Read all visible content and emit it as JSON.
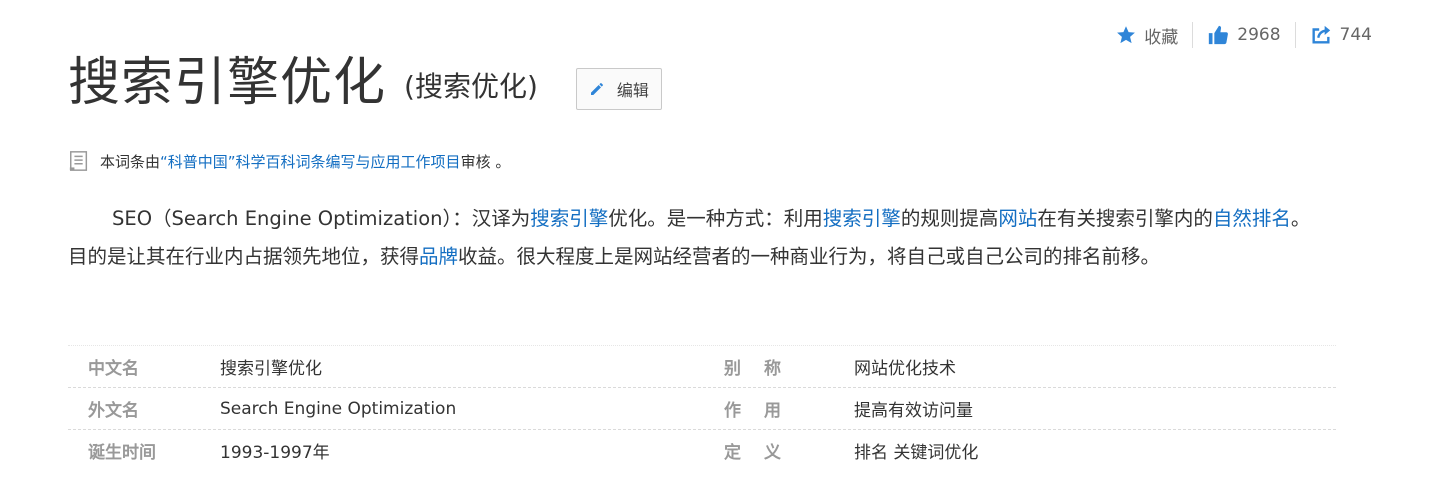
{
  "actions": {
    "favorite_label": "收藏",
    "like_count": "2968",
    "share_count": "744",
    "accent_color": "#2f85d8"
  },
  "title": {
    "main": "搜索引擎优化",
    "sub": "(搜索优化)",
    "edit_label": "编辑"
  },
  "review": {
    "prefix": "本词条由",
    "link": "“科普中国”科学百科词条编写与应用工作项目",
    "suffix": " 审核 。"
  },
  "summary": {
    "parts": [
      "SEO（Search Engine Optimization）：汉译为",
      "搜索引擎",
      "优化。是一种方式：利用",
      "搜索引擎",
      "的规则提高",
      "网站",
      "在有关搜索引擎内的",
      "自然排名",
      "。目的是让其在行业内占据领先地位，获得",
      "品牌",
      "收益。很大程度上是网站经营者的一种商业行为，将自己或自己公司的排名前移。"
    ]
  },
  "basic_info": [
    {
      "name": "中文名",
      "value": "搜索引擎优化",
      "name2": "别　称",
      "value2": "网站优化技术"
    },
    {
      "name": "外文名",
      "value": "Search Engine Optimization",
      "name2": "作　用",
      "value2": "提高有效访问量"
    },
    {
      "name": "诞生时间",
      "value": "1993-1997年",
      "name2": "定　义",
      "value2": "排名 关键词优化"
    }
  ]
}
